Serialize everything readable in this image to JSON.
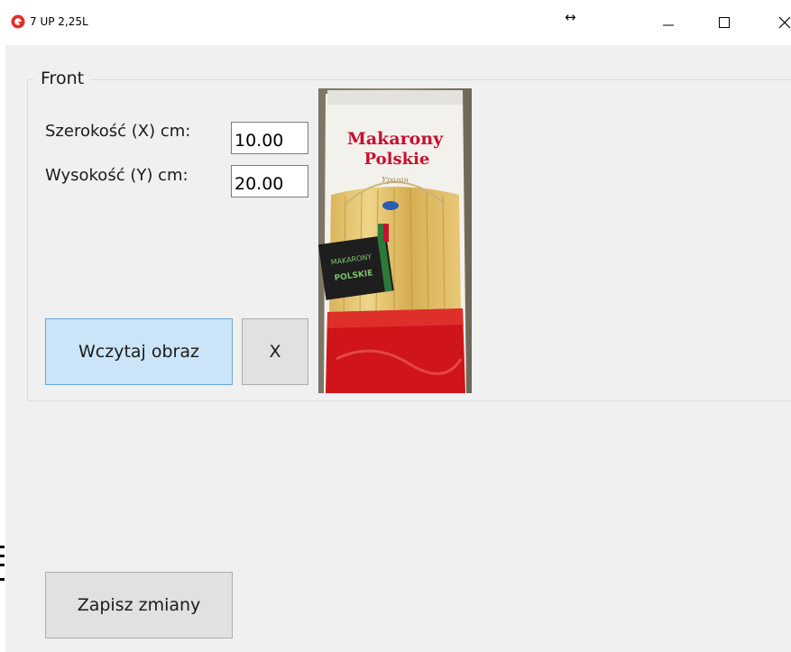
{
  "window": {
    "title": "7 UP 2,25L",
    "resize_glyph": "↔",
    "controls": {
      "minimize": "minimize",
      "maximize": "maximize",
      "close": "close"
    }
  },
  "front_group": {
    "legend": "Front",
    "width_label": "Szerokość (X) cm:",
    "width_value": "10.00",
    "height_label": "Wysokość (Y) cm:",
    "height_value": "20.00",
    "load_button_label": "Wczytaj obraz",
    "clear_button_label": "X",
    "preview": {
      "brand_line1": "Makarony",
      "brand_line2": "Polskie",
      "sub_line": "Ураган",
      "sticker_line1": "MAKARONY",
      "sticker_line2": "POLSKIE"
    }
  },
  "save_button_label": "Zapisz zmiany",
  "colors": {
    "client_bg": "#f0f0f0",
    "button_bg": "#e1e1e1",
    "button_focus_bg": "#cce4f7",
    "button_focus_border": "#6aa6d6",
    "app_icon": "#e0302a",
    "brand_red": "#c8102e"
  },
  "icons": {
    "app": "app-icon",
    "minimize": "minimize-icon",
    "maximize": "maximize-icon",
    "close": "close-icon"
  }
}
